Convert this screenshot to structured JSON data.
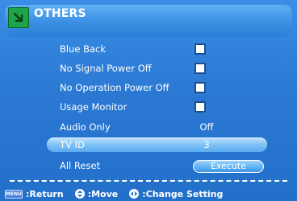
{
  "header": {
    "title": "OTHERS",
    "icon": "arrow-down-right-icon"
  },
  "menu": {
    "items": [
      {
        "label": "Blue Back",
        "control": "checkbox",
        "checked": true
      },
      {
        "label": "No Signal Power Off",
        "control": "checkbox",
        "checked": true
      },
      {
        "label": "No Operation Power Off",
        "control": "checkbox",
        "checked": true
      },
      {
        "label": "Usage Monitor",
        "control": "checkbox",
        "checked": true
      },
      {
        "label": "Audio Only",
        "control": "value",
        "value": "Off"
      },
      {
        "label": "TV ID",
        "control": "value",
        "value": "3",
        "selected": true
      },
      {
        "label": "All Reset",
        "control": "button",
        "button_label": "Execute"
      }
    ]
  },
  "footer": {
    "menu_key": "MENU",
    "return_label": ":Return",
    "move_label": ":Move",
    "change_label": ":Change Setting"
  },
  "colors": {
    "background": "#2b79d3",
    "highlight": "#7ec2f6",
    "icon_green": "#1ea44a"
  }
}
